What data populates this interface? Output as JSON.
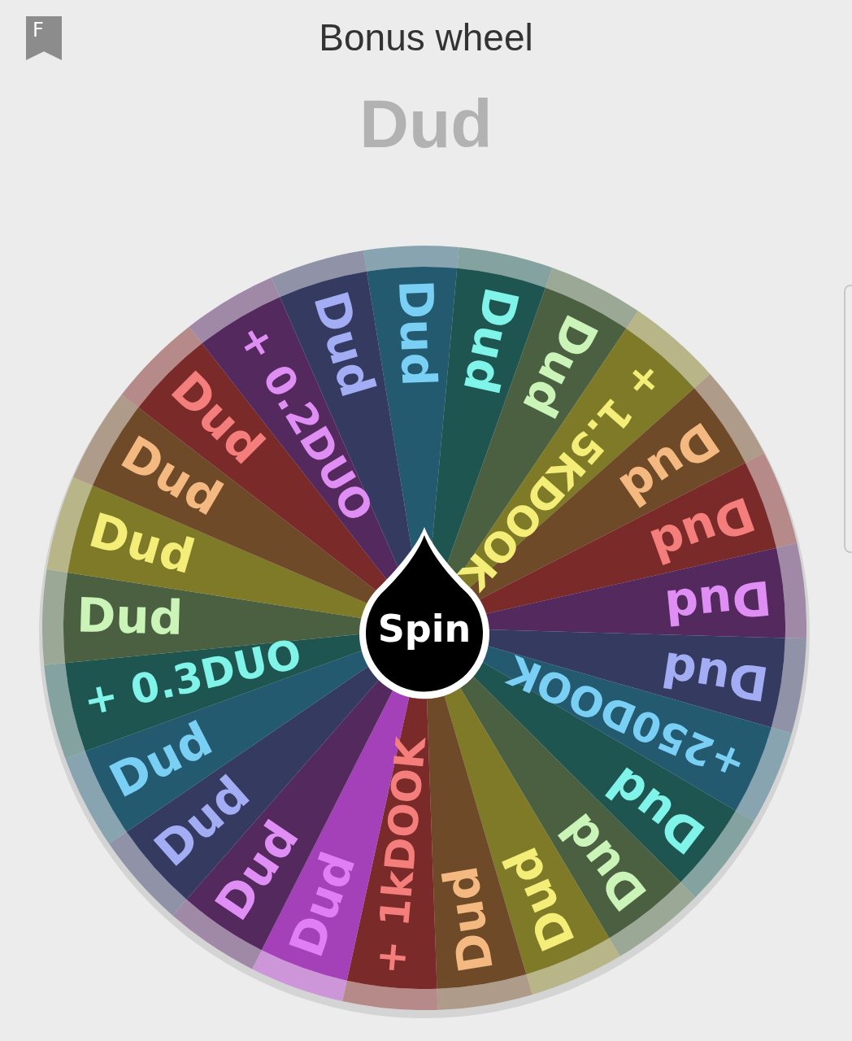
{
  "header": {
    "badge": "F",
    "title": "Bonus wheel"
  },
  "result": "Dud",
  "spin_button": {
    "label": "Spin"
  },
  "segments": [
    {
      "label": "Dud",
      "color": "#245a70"
    },
    {
      "label": "Dud",
      "color": "#1f5550"
    },
    {
      "label": "Dud",
      "color": "#4a6040"
    },
    {
      "label": "+ 1.5KDOOK",
      "color": "#7e7a28"
    },
    {
      "label": "Dud",
      "color": "#6e4a28"
    },
    {
      "label": "Dud",
      "color": "#7a2a28"
    },
    {
      "label": "Dud",
      "color": "#53295e"
    },
    {
      "label": "Dud",
      "color": "#353a60"
    },
    {
      "label": "+250DOOK",
      "color": "#245a70"
    },
    {
      "label": "Dud",
      "color": "#1f5550"
    },
    {
      "label": "Dud",
      "color": "#4a6040"
    },
    {
      "label": "Dud",
      "color": "#7e7a28"
    },
    {
      "label": "Dud",
      "color": "#6e4a28"
    },
    {
      "label": "+ 1kDOOK",
      "color": "#7a2a28"
    },
    {
      "label": "Dud",
      "color": "#a440b8"
    },
    {
      "label": "Dud",
      "color": "#53295e"
    },
    {
      "label": "Dud",
      "color": "#353a60"
    },
    {
      "label": "Dud",
      "color": "#245a70"
    },
    {
      "label": "+ 0.3DUO",
      "color": "#1f5550"
    },
    {
      "label": "Dud",
      "color": "#4a6040"
    },
    {
      "label": "Dud",
      "color": "#7e7a28"
    },
    {
      "label": "Dud",
      "color": "#6e4a28"
    },
    {
      "label": "Dud",
      "color": "#7a2a28"
    },
    {
      "label": "+ 0.2DUO",
      "color": "#53295e"
    },
    {
      "label": "Dud",
      "color": "#353a60"
    }
  ]
}
